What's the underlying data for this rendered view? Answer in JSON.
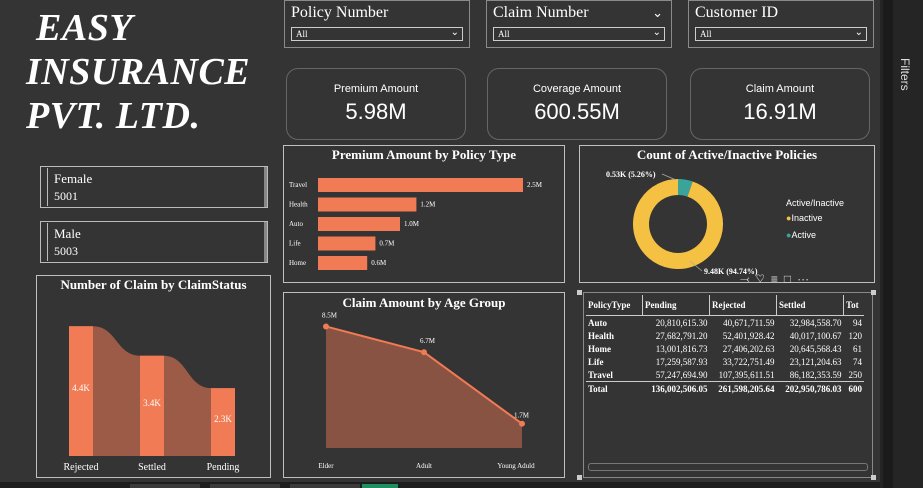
{
  "company": {
    "line1": "EASY",
    "line2": "INSURANCE",
    "line3": "PVT. LTD."
  },
  "slicers": [
    {
      "label": "Policy Number",
      "value": "All",
      "chevron": false
    },
    {
      "label": "Claim Number",
      "value": "All",
      "chevron": true
    },
    {
      "label": "Customer ID",
      "value": "All",
      "chevron": false
    }
  ],
  "kpis": [
    {
      "label": "Premium Amount",
      "value": "5.98M"
    },
    {
      "label": "Coverage Amount",
      "value": "600.55M"
    },
    {
      "label": "Claim Amount",
      "value": "16.91M"
    }
  ],
  "gender_cards": [
    {
      "label": "Female",
      "value": "5001"
    },
    {
      "label": "Male",
      "value": "5003"
    }
  ],
  "side_pane": {
    "label": "Filters"
  },
  "chart_data": [
    {
      "type": "bar",
      "title": "Premium Amount by Policy Type",
      "orientation": "horizontal",
      "categories": [
        "Travel",
        "Health",
        "Auto",
        "Life",
        "Home"
      ],
      "values": [
        2.5,
        1.2,
        1.0,
        0.7,
        0.6
      ],
      "labels": [
        "2.5M",
        "1.2M",
        "1.0M",
        "0.7M",
        "0.6M"
      ],
      "color": "#f07b55"
    },
    {
      "type": "pie",
      "title": "Count of Active/Inactive Policies",
      "legend_title": "Active/Inactive",
      "legend_position": "right",
      "slices": [
        {
          "name": "Inactive",
          "value": 9.48,
          "label": "9.48K (94.74%)",
          "color": "#f5c142"
        },
        {
          "name": "Active",
          "value": 0.53,
          "label": "0.53K (5.26%)",
          "color": "#3aa39a"
        }
      ]
    },
    {
      "type": "area",
      "title": "Number of Claim by ClaimStatus",
      "categories": [
        "Rejected",
        "Settled",
        "Pending"
      ],
      "values": [
        4.4,
        3.4,
        2.3
      ],
      "labels": [
        "4.4K",
        "3.4K",
        "2.3K"
      ],
      "color": "#f07b55"
    },
    {
      "type": "area",
      "title": "Claim Amount by Age Group",
      "categories": [
        "Elder",
        "Adult",
        "Young Aduld"
      ],
      "values": [
        8.5,
        6.7,
        1.7
      ],
      "labels": [
        "8.5M",
        "6.7M",
        "1.7M"
      ],
      "color": "#f07b55"
    },
    {
      "type": "table",
      "columns": [
        "PolicyType",
        "Pending",
        "Rejected",
        "Settled",
        "Tot"
      ],
      "rows": [
        [
          "Auto",
          "20,810,615.30",
          "40,671,711.59",
          "32,984,558.70",
          "94"
        ],
        [
          "Health",
          "27,682,791.20",
          "52,401,928.42",
          "40,017,100.67",
          "120"
        ],
        [
          "Home",
          "13,001,816.73",
          "27,406,202.63",
          "20,645,568.43",
          "61"
        ],
        [
          "Life",
          "17,259,587.93",
          "33,722,751.49",
          "23,121,204.63",
          "74"
        ],
        [
          "Travel",
          "57,247,694.90",
          "107,395,611.51",
          "86,182,353.59",
          "250"
        ]
      ],
      "total": [
        "Total",
        "136,002,506.05",
        "261,598,205.64",
        "202,950,786.03",
        "600"
      ]
    }
  ]
}
